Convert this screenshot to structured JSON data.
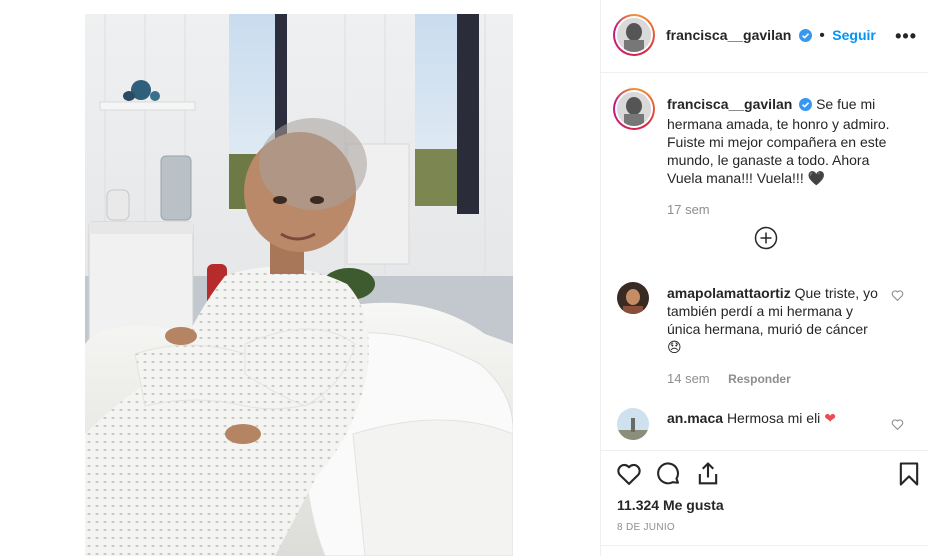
{
  "post": {
    "username": "francisca__gavilan",
    "follow_label": "Seguir",
    "more_label": "•••",
    "caption": "Se fue mi hermana amada, te honro y admiro. Fuiste mi mejor compañera en este mundo, le ganaste a todo. Ahora Vuela mana!!! Vuela!!!",
    "caption_emoji": "🖤",
    "caption_time": "17 sem",
    "load_more_icon": "plus-circle-icon",
    "likes": "11.324 Me gusta",
    "date": "8 DE JUNIO"
  },
  "comments": [
    {
      "username": "amapolamattaortiz",
      "text": "Que triste, yo también perdí a mi hermana y única hermana, murió de cáncer",
      "emoji": "😞",
      "time": "14 sem",
      "reply_label": "Responder"
    },
    {
      "username": "an.maca",
      "text": "Hermosa mi eli",
      "emoji": "❤"
    }
  ],
  "icons": [
    "heart-icon",
    "comment-icon",
    "share-icon",
    "bookmark-icon",
    "verified-badge-icon"
  ],
  "colors": {
    "accent": "#0095f6",
    "verified": "#3897f0",
    "like": "#ed4956",
    "muted": "#8e8e8e"
  }
}
